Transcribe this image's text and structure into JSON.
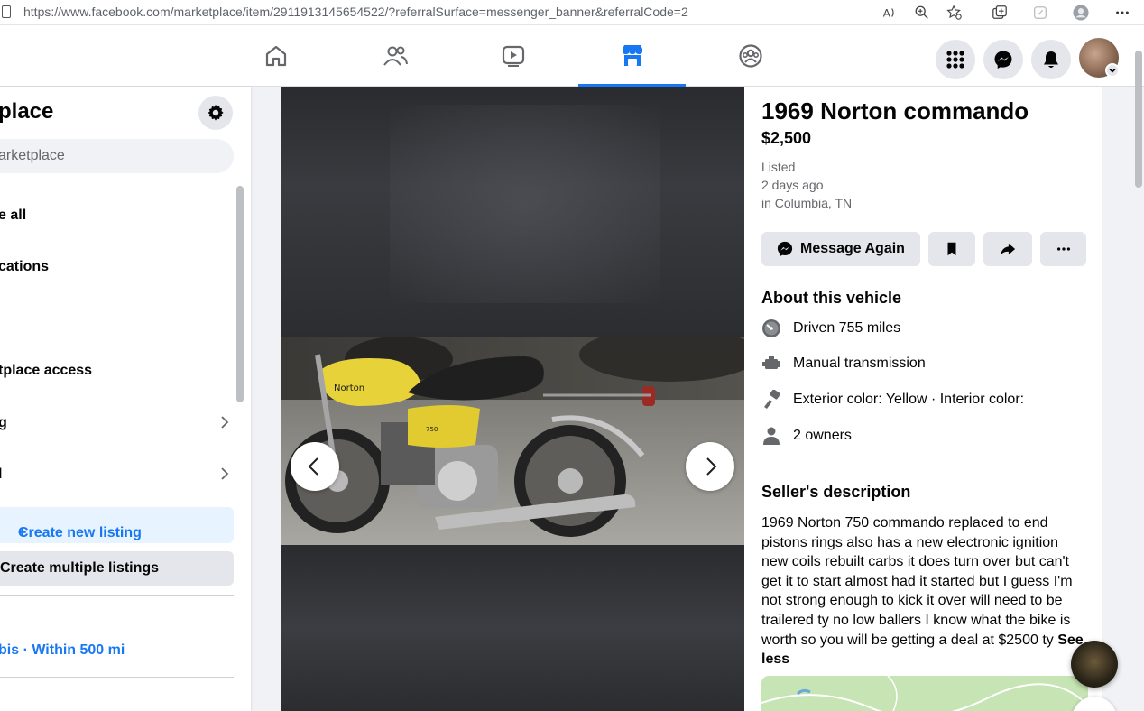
{
  "browser": {
    "url": "https://www.facebook.com/marketplace/item/2911913145654522/?referralSurface=messenger_banner&referralCode=2"
  },
  "sidebar": {
    "title": "place",
    "search_placeholder": "arketplace",
    "items": [
      {
        "label": "e all"
      },
      {
        "label": "cations"
      },
      {
        "label": "tplace access"
      },
      {
        "label": "g"
      },
      {
        "label": "l"
      }
    ],
    "create_listing_label": "Create new listing",
    "create_multiple_label": "Create multiple listings",
    "location_label": "bis · Within 500 mi"
  },
  "listing": {
    "title": "1969 Norton commando",
    "price": "$2,500",
    "listed_label": "Listed",
    "listed_time": "2 days ago",
    "location": "in Columbia, TN",
    "message_button": "Message Again",
    "about_heading": "About this vehicle",
    "specs": [
      {
        "icon": "speedometer-icon",
        "text": "Driven 755 miles"
      },
      {
        "icon": "engine-icon",
        "text": "Manual transmission"
      },
      {
        "icon": "paint-icon",
        "text": "Exterior color: Yellow · Interior color:"
      },
      {
        "icon": "person-icon",
        "text": "2 owners"
      }
    ],
    "seller_heading": "Seller's description",
    "description": "1969 Norton 750 commando replaced to end pistons rings also has a new electronic ignition new coils rebuilt carbs it does turn over but can't get it to start almost had it started but I guess I'm not strong enough to kick it over will need to be trailered ty no low ballers I know what the bike is worth so you will be getting a deal at $2500 ty",
    "see_less": "See less"
  },
  "colors": {
    "accent": "#1877f2",
    "bike_tank": "#e8d23a"
  }
}
